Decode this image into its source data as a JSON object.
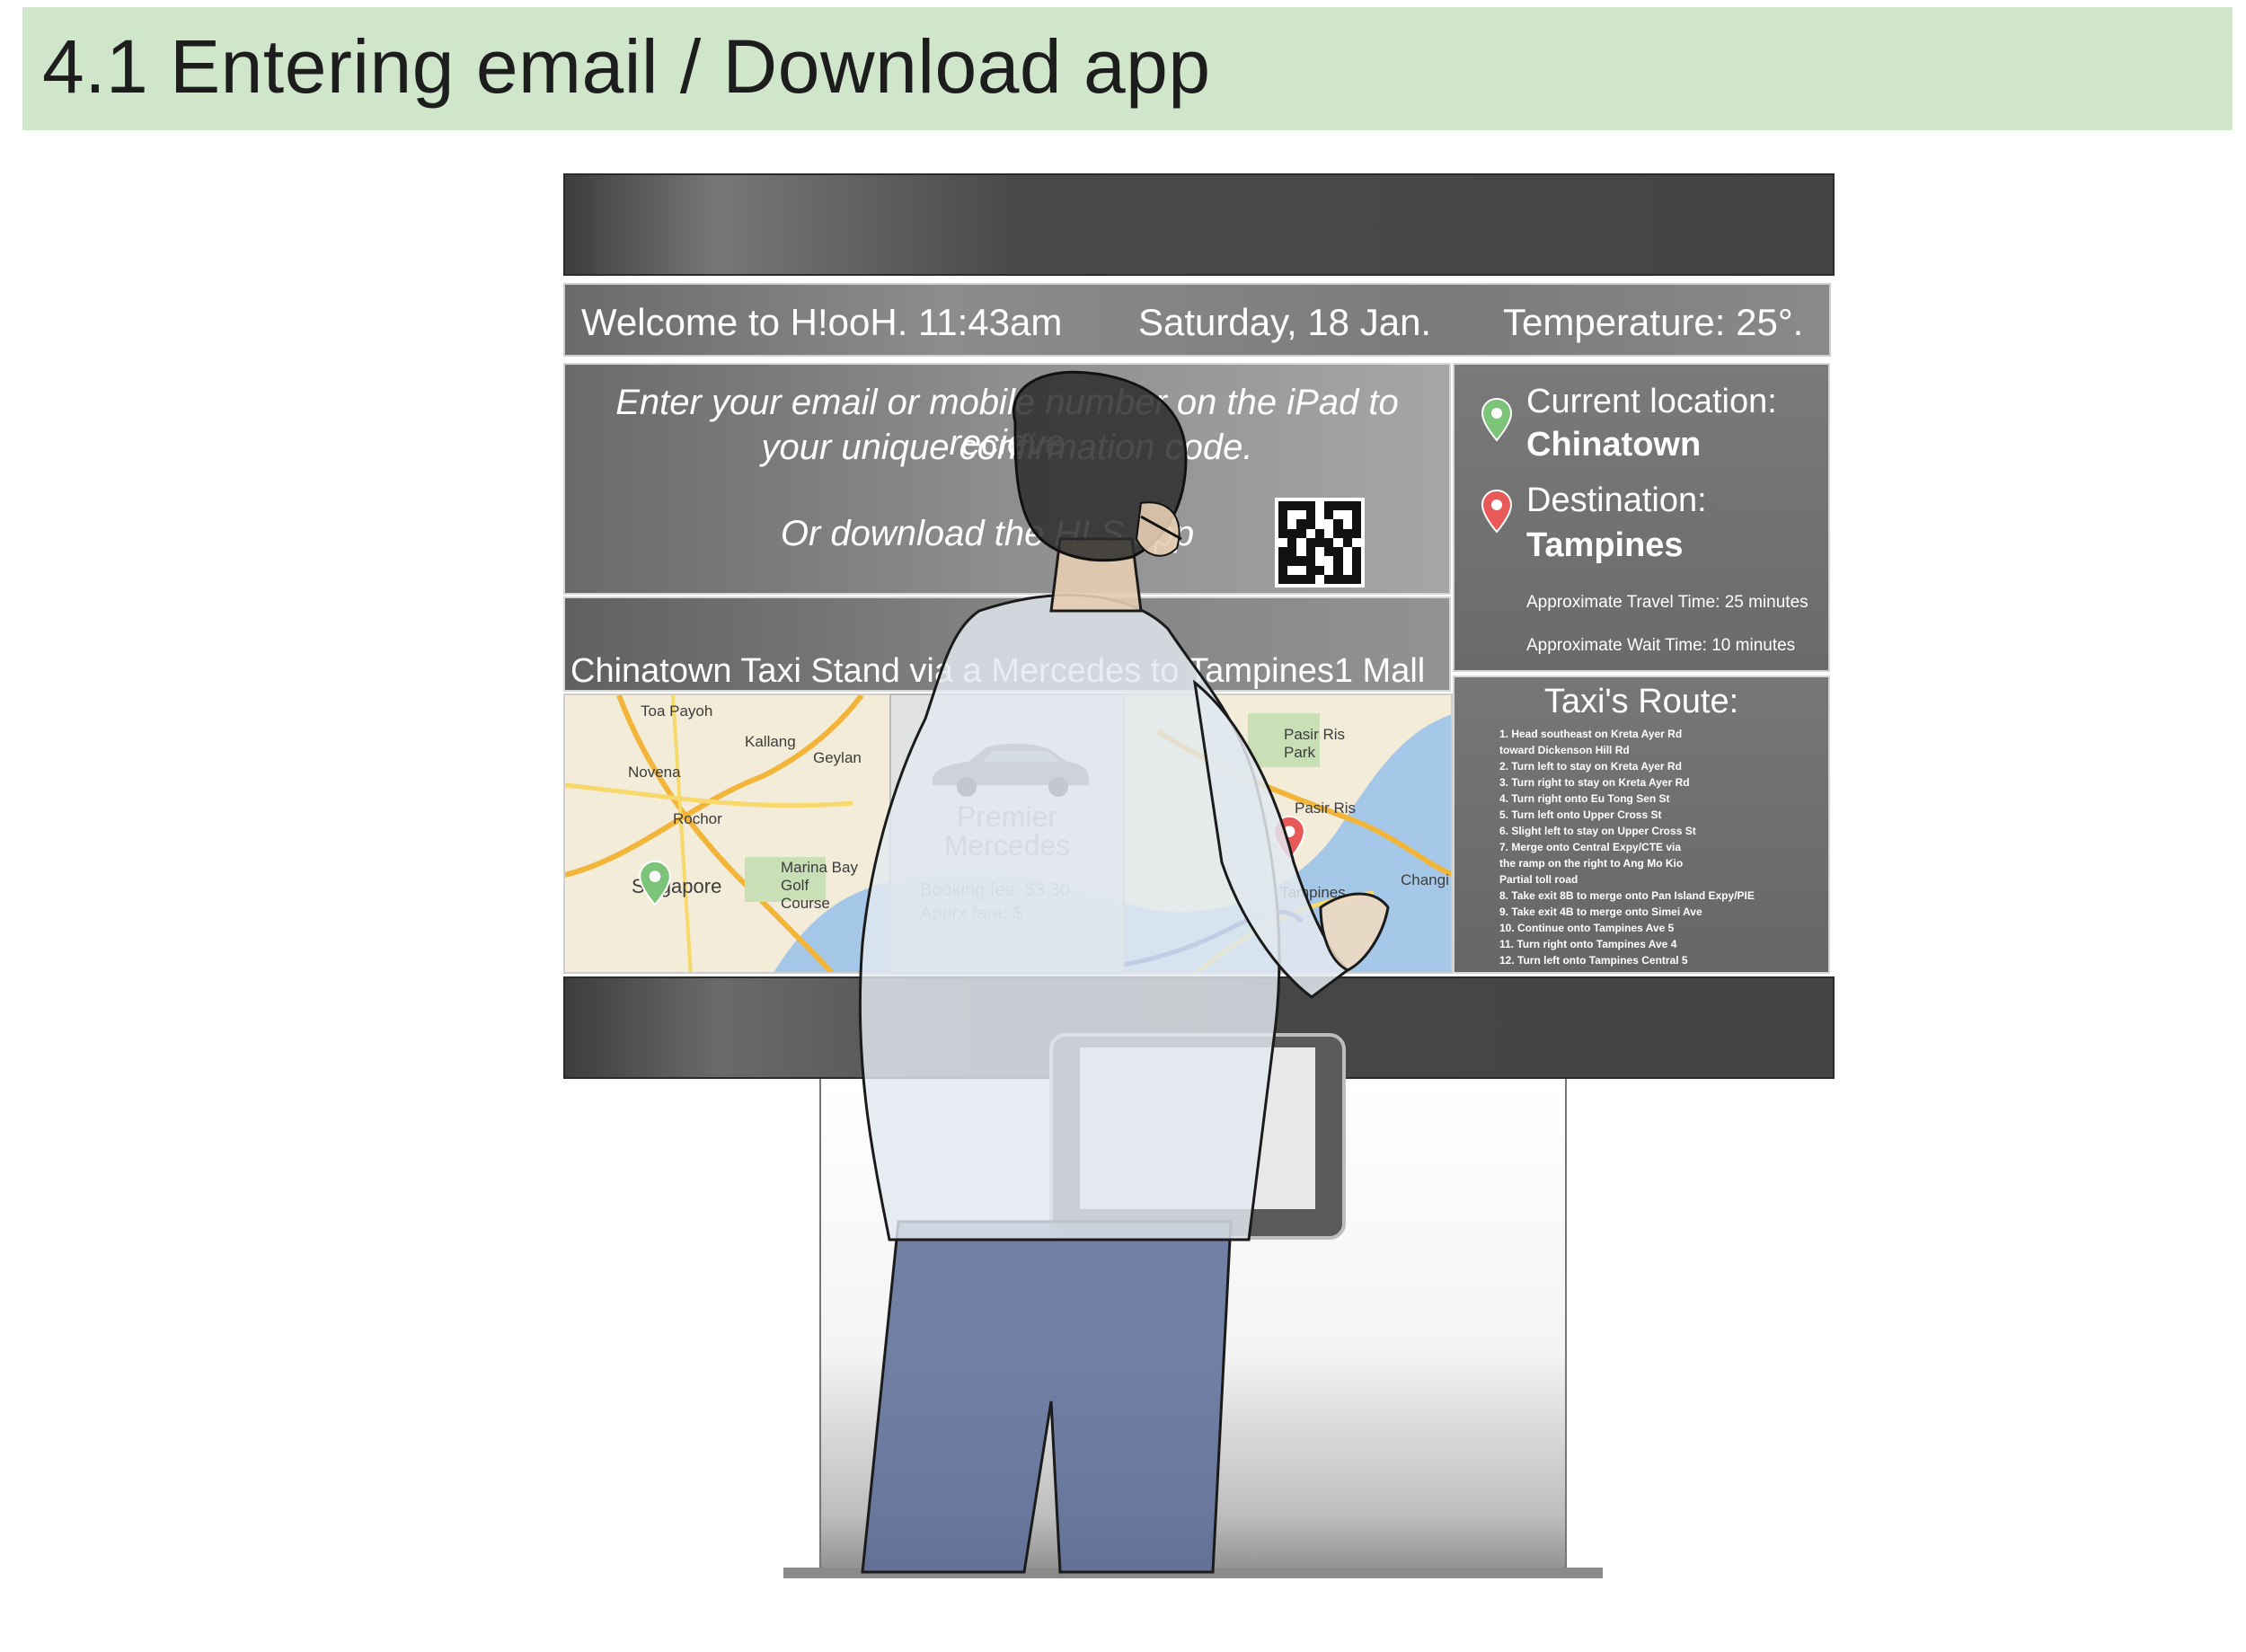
{
  "slide": {
    "title": "4.1 Entering email / Download app"
  },
  "info_bar": {
    "welcome": "Welcome to H!ooH. 11:43am",
    "date": "Saturday, 18 Jan.",
    "temperature": "Temperature: 25°."
  },
  "instructions": {
    "line1": "Enter your email or mobile number on the iPad to recieve",
    "line2": "your unique confirmation code.",
    "line3": "Or download the H! S app"
  },
  "location": {
    "current_label": "Current location:",
    "current_value": "Chinatown",
    "destination_label": "Destination:",
    "destination_value": "Tampines",
    "travel_time": "Approximate Travel Time: 25 minutes",
    "wait_time": "Approximate Wait Time: 10 minutes"
  },
  "route_header": {
    "text": "Chinatown Taxi Stand  via a Mercedes  to Tampines1 Mall"
  },
  "map": {
    "labels": [
      "Toa Payoh",
      "Kallang",
      "Geylan",
      "Novena",
      "Rochor",
      "Singapore",
      "Marina Bay Golf Course",
      "Pasir Ris Park",
      "Pasir Ris",
      "Tampines",
      "Changi"
    ]
  },
  "car_card": {
    "name_line1": "Premier",
    "name_line2": "Mercedes",
    "booking_fee": "Booking fee: $3.30",
    "approx_fare": "Apprx fare:   $"
  },
  "route": {
    "title": "Taxi's Route:",
    "steps": [
      "1. Head southeast on Kreta Ayer Rd",
      "      toward Dickenson Hill Rd",
      "2. Turn left to stay on Kreta Ayer Rd",
      "3. Turn right to stay on Kreta Ayer Rd",
      "4. Turn right onto Eu Tong Sen St",
      "5. Turn left onto Upper Cross St",
      "6. Slight left to stay on Upper Cross St",
      "7. Merge onto Central Expy/CTE via",
      "      the ramp on the right to Ang Mo Kio",
      "Partial toll road",
      "8. Take exit 8B to merge onto Pan Island Expy/PIE",
      "9. Take exit 4B to merge onto Simei Ave",
      "10. Continue onto Tampines Ave 5",
      "11. Turn right onto Tampines Ave 4",
      "12. Turn left onto Tampines Central 5"
    ]
  },
  "colors": {
    "banner": "#cfe6cb",
    "kiosk": "#444444",
    "pin_green": "#7cc47a",
    "pin_red": "#e85a5a"
  },
  "icons": [
    "qr-code-icon",
    "green-location-pin-icon",
    "red-location-pin-icon",
    "car-icon"
  ]
}
